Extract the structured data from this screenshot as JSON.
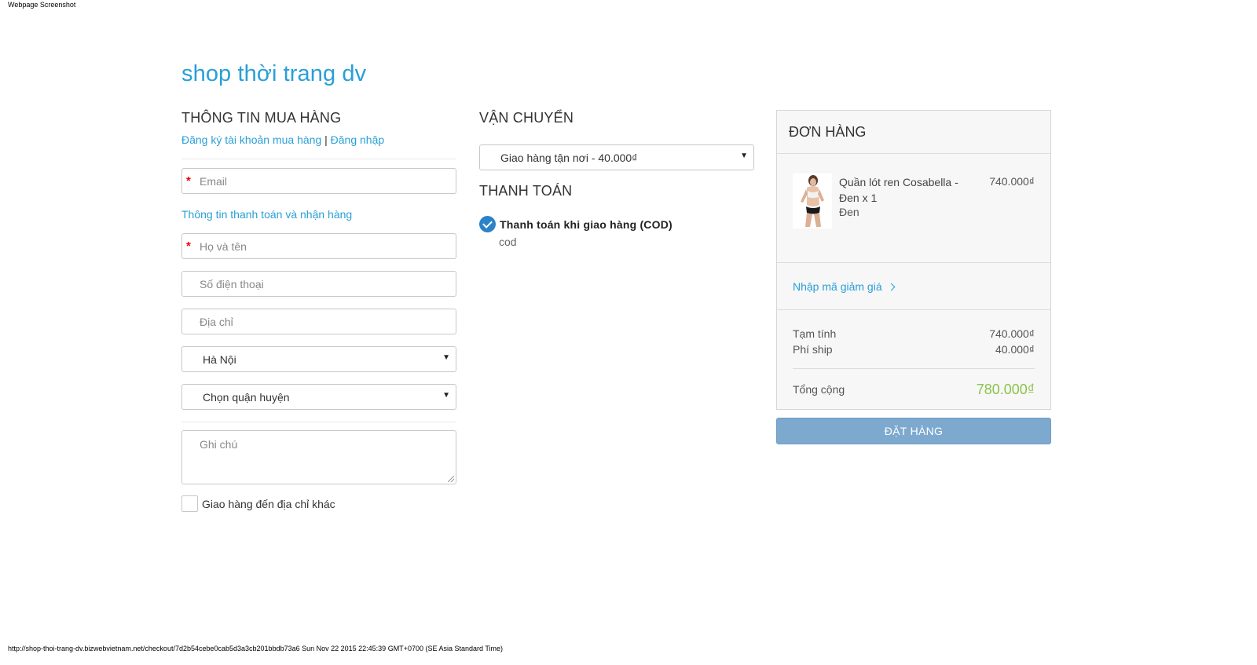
{
  "print": {
    "header": "Webpage Screenshot",
    "footer": "http://shop-thoi-trang-dv.bizwebvietnam.net/checkout/7d2b54cebe0cab5d3a3cb201bbdb73a6 Sun Nov 22 2015 22:45:39 GMT+0700 (SE Asia Standard Time)"
  },
  "shop": {
    "title": "shop thời trang dv"
  },
  "buyer": {
    "title": "THÔNG TIN MUA HÀNG",
    "register_link": "Đăng ký tài khoản mua hàng",
    "separator": "|",
    "login_link": "Đăng nhập",
    "email_placeholder": "Email",
    "billing_link": "Thông tin thanh toán và nhận hàng",
    "name_placeholder": "Họ và tên",
    "phone_placeholder": "Số điện thoại",
    "address_placeholder": "Địa chỉ",
    "city_value": "Hà Nội",
    "district_value": "Chọn quận huyện",
    "note_placeholder": "Ghi chú",
    "alt_address_label": "Giao hàng đến địa chỉ khác",
    "required_mark": "*"
  },
  "shipping": {
    "title": "VẬN CHUYỂN",
    "selected": "Giao hàng tận nơi - 40.000₫"
  },
  "payment": {
    "title": "THANH TOÁN",
    "method_label": "Thanh toán khi giao hàng (COD)",
    "method_desc": "cod"
  },
  "order": {
    "title": "ĐƠN HÀNG",
    "product_name": "Quần lót ren Cosabella - Đen x 1",
    "product_variant": "Đen",
    "product_price": "740.000₫",
    "discount_link": "Nhập mã giảm giá",
    "subtotal_label": "Tạm tính",
    "subtotal_value": "740.000₫",
    "shipping_label": "Phí ship",
    "shipping_value": "40.000₫",
    "total_label": "Tổng cộng",
    "total_value": "780.000₫",
    "submit_label": "ĐẶT HÀNG"
  },
  "colors": {
    "accent": "#2a9fd6",
    "total": "#8bc34a",
    "button": "#7ea9cf",
    "required": "#ee0000"
  },
  "icons": [
    "select-caret-icon",
    "check-circle-icon",
    "chevron-right-icon",
    "product-thumbnail",
    "resize-grip-icon"
  ]
}
